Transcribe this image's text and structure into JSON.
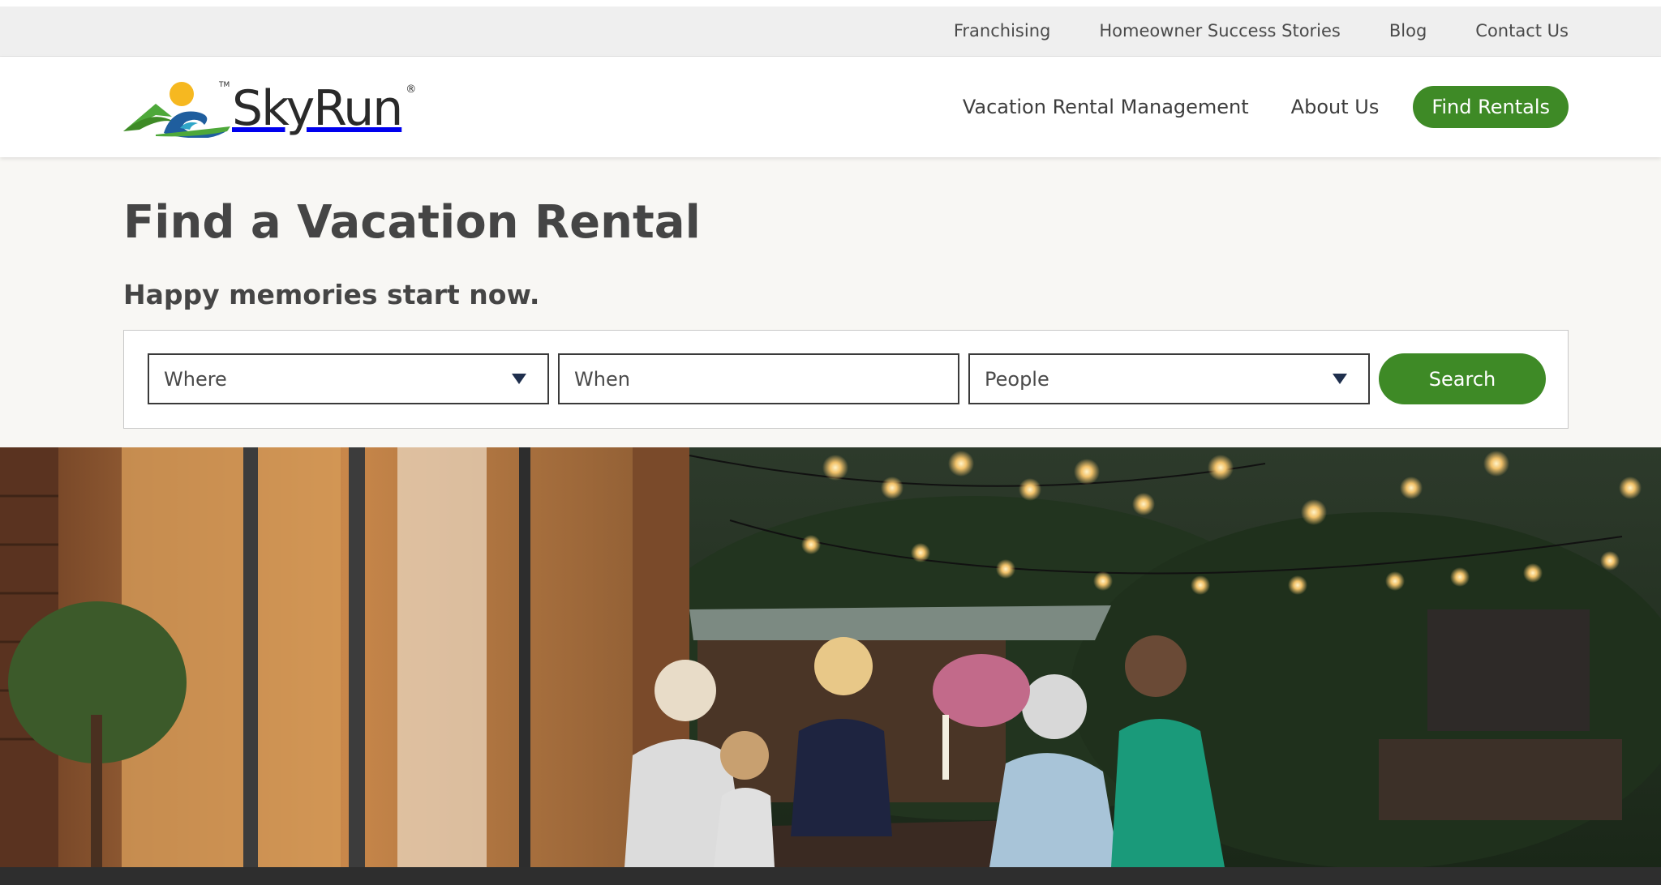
{
  "utility_nav": {
    "items": [
      "Franchising",
      "Homeowner Success Stories",
      "Blog",
      "Contact Us"
    ]
  },
  "header": {
    "logo": {
      "text": "SkyRun",
      "registered": "®",
      "trademark": "TM"
    },
    "nav": {
      "items": [
        "Vacation Rental Management",
        "About Us"
      ],
      "cta_label": "Find Rentals"
    }
  },
  "search": {
    "title": "Find a Vacation Rental",
    "subtitle": "Happy memories start now.",
    "where_label": "Where",
    "when_label": "When",
    "people_label": "People",
    "button_label": "Search"
  },
  "hero": {
    "description_icon": "family-dinner-outdoor-photo"
  },
  "colors": {
    "brand_green": "#3e8a26",
    "text_dark": "#454545",
    "utility_bg": "#efefef",
    "section_bg": "#f8f7f4"
  }
}
